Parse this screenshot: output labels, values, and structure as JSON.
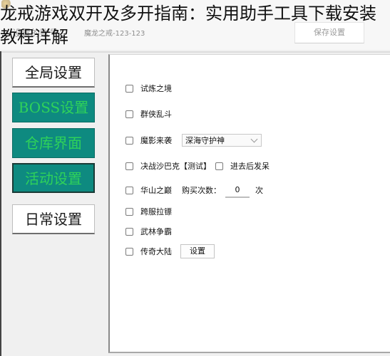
{
  "overlay_title": "龙戒游戏双开及多开指南：实用助手工具下载安装教程详解",
  "header": {
    "account_label": "设置的账号：",
    "account_value": "魔龙之戒-123-123",
    "save_button": "保存设置"
  },
  "sidebar": {
    "items": [
      {
        "label": "全局设置",
        "style": "white"
      },
      {
        "label": "BOSS设置",
        "style": "teal"
      },
      {
        "label": "仓库界面",
        "style": "teal"
      },
      {
        "label": "活动设置",
        "style": "teal",
        "active": true
      },
      {
        "label": "日常设置",
        "style": "white"
      }
    ]
  },
  "activities": [
    {
      "label": "试炼之境",
      "checked": false
    },
    {
      "label": "群侠乱斗",
      "checked": false
    },
    {
      "label": "魔影来袭",
      "checked": false,
      "dropdown": {
        "selected": "深海守护神"
      }
    },
    {
      "label": "决战沙巴克【测试】",
      "checked": false,
      "extra_checkbox": {
        "label": "进去后发呆",
        "checked": false
      }
    },
    {
      "label": "华山之巅",
      "checked": false,
      "purchase": {
        "label": "购买次数：",
        "value": "0",
        "unit": "次"
      }
    },
    {
      "label": "跨服拉镖",
      "checked": false
    },
    {
      "label": "武林争霸",
      "checked": false
    },
    {
      "label": "传奇大陆",
      "checked": false,
      "button": "设置"
    }
  ],
  "colors": {
    "teal_bg": "#0e8a80",
    "teal_text": "#2fd25a"
  }
}
